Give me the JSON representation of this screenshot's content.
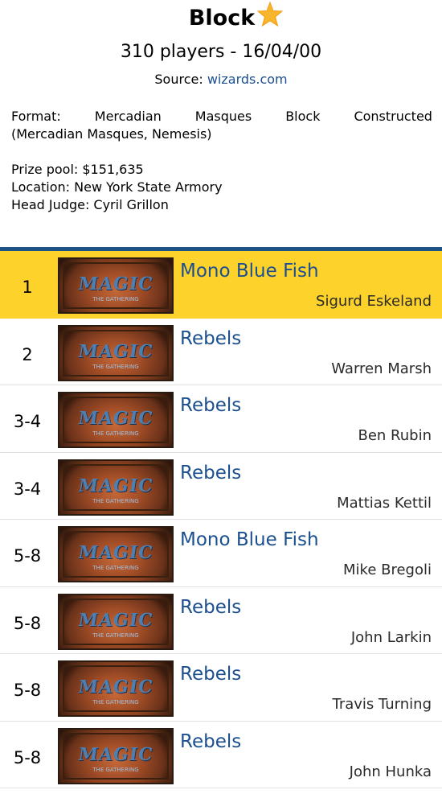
{
  "header": {
    "title": "Block",
    "star_icon": "star-icon",
    "subtitle": "310 players - 16/04/00",
    "source_label": "Source:",
    "source_link": "wizards.com"
  },
  "info": {
    "format_words": [
      "Format:",
      "Mercadian",
      "Masques",
      "Block",
      "Constructed"
    ],
    "format_line2": "(Mercadian Masques, Nemesis)",
    "prize_pool": "Prize pool: $151,635",
    "location": "Location: New York State Armory",
    "head_judge": "Head Judge: Cyril Grillon"
  },
  "colors": {
    "accent_blue": "#1b4f8f",
    "divider": "#1d5386",
    "highlight": "#fdd22a"
  },
  "card_logo": {
    "text": "MAGIC",
    "sub": "THE GATHERING"
  },
  "standings": [
    {
      "rank": "1",
      "deck": "Mono Blue Fish",
      "player": "Sigurd Eskeland"
    },
    {
      "rank": "2",
      "deck": "Rebels",
      "player": "Warren Marsh"
    },
    {
      "rank": "3-4",
      "deck": "Rebels",
      "player": "Ben Rubin"
    },
    {
      "rank": "3-4",
      "deck": "Rebels",
      "player": "Mattias Kettil"
    },
    {
      "rank": "5-8",
      "deck": "Mono Blue Fish",
      "player": "Mike Bregoli"
    },
    {
      "rank": "5-8",
      "deck": "Rebels",
      "player": "John Larkin"
    },
    {
      "rank": "5-8",
      "deck": "Rebels",
      "player": "Travis Turning"
    },
    {
      "rank": "5-8",
      "deck": "Rebels",
      "player": "John Hunka"
    }
  ]
}
